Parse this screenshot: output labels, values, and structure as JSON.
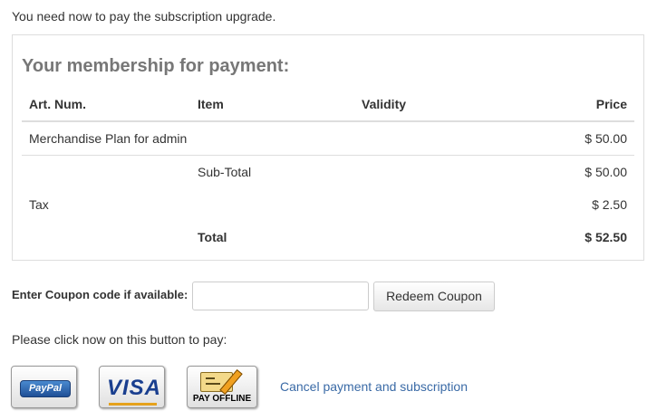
{
  "intro_text": "You need now to pay the subscription upgrade.",
  "panel": {
    "title": "Your membership for payment:",
    "columns": [
      "Art. Num.",
      "Item",
      "Validity",
      "Price"
    ],
    "line_item": {
      "art_num": "Merchandise Plan for admin",
      "price": "$ 50.00"
    },
    "subtotal": {
      "label": "Sub-Total",
      "value": "$ 50.00"
    },
    "tax": {
      "label": "Tax",
      "value": "$ 2.50"
    },
    "total": {
      "label": "Total",
      "value": "$ 52.50"
    }
  },
  "coupon": {
    "label": "Enter Coupon code if available:",
    "value": "",
    "placeholder": "",
    "button_label": "Redeem Coupon"
  },
  "pay_prompt": "Please click now on this button to pay:",
  "payment_buttons": {
    "paypal_label": "PayPal",
    "visa_label": "VISA",
    "offline_label": "PAY OFFLINE"
  },
  "cancel_link": "Cancel payment and subscription",
  "colors": {
    "link": "#3a6aa6",
    "title_gray": "#777777",
    "border": "#dddddd"
  }
}
